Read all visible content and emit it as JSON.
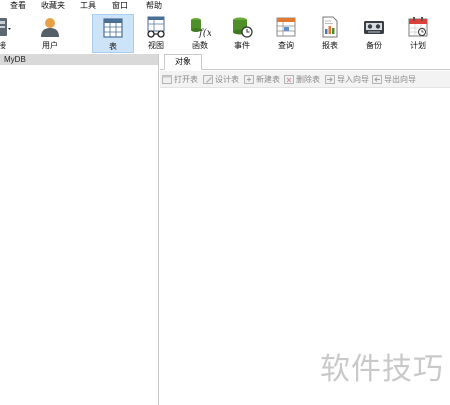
{
  "menubar": {
    "items": [
      "查看",
      "收藏夹",
      "工具",
      "窗口",
      "帮助"
    ]
  },
  "toolbar": {
    "connection_label": "接",
    "user_label": "用户",
    "tools": [
      {
        "label": "表",
        "icon": "table-icon",
        "active": true
      },
      {
        "label": "视图",
        "icon": "view-icon",
        "active": false
      },
      {
        "label": "函数",
        "icon": "function-icon",
        "active": false
      },
      {
        "label": "事件",
        "icon": "event-icon",
        "active": false
      },
      {
        "label": "查询",
        "icon": "query-icon",
        "active": false
      },
      {
        "label": "报表",
        "icon": "report-icon",
        "active": false
      },
      {
        "label": "备份",
        "icon": "backup-icon",
        "active": false
      },
      {
        "label": "计划",
        "icon": "schedule-icon",
        "active": false
      }
    ]
  },
  "left_panel": {
    "connection_name": "MyDB"
  },
  "right_panel": {
    "tab_label": "对象",
    "actions": [
      "打开表",
      "设计表",
      "新建表",
      "删除表",
      "导入向导",
      "导出向导"
    ]
  },
  "watermark": "软件技巧",
  "colors": {
    "active_tool_bg": "#cde3f7",
    "selected_row_bg": "#d9d9d9",
    "object_toolbar_bg": "#f3f3f3",
    "disabled_text": "#8a8a8a"
  }
}
